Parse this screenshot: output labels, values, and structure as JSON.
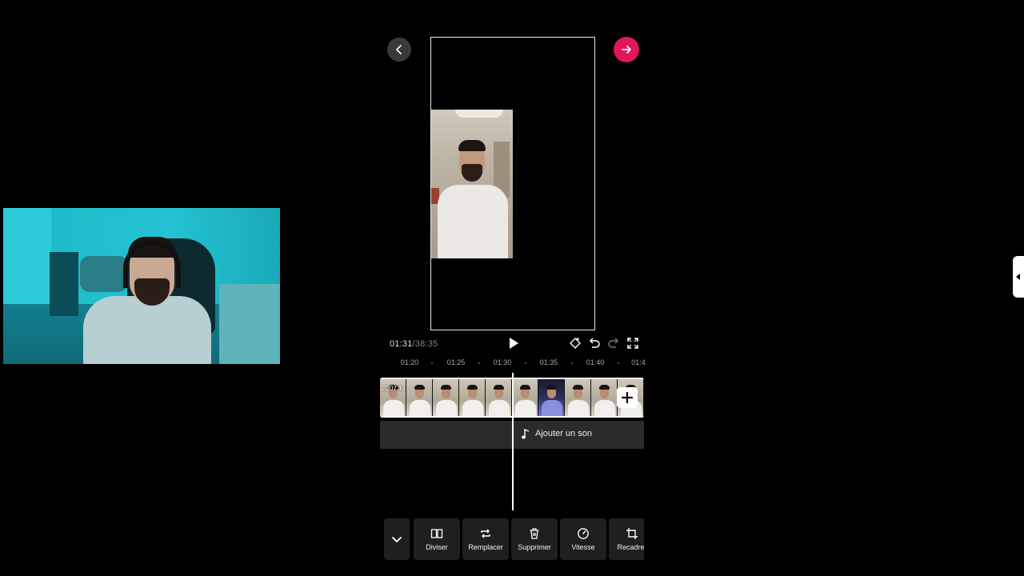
{
  "preview": {
    "current_time": "01:31",
    "separator": "/",
    "total_time": "38:35"
  },
  "ruler": {
    "ticks": [
      "01:20",
      "01:25",
      "01:30",
      "01:35",
      "01:40",
      "01:4"
    ]
  },
  "clip": {
    "duration_label": "2307.1s"
  },
  "audio": {
    "add_sound_label": "Ajouter un son"
  },
  "toolbar": {
    "split_label": "Diviser",
    "replace_label": "Remplacer",
    "delete_label": "Supprimer",
    "speed_label": "Vitesse",
    "crop_label": "Recadrer"
  },
  "colors": {
    "accent": "#e0155c",
    "background": "#000000",
    "tool_bg": "#1f1f1f"
  },
  "icons": [
    "back-icon",
    "next-arrow-icon",
    "play-icon",
    "keyframe-icon",
    "undo-icon",
    "redo-icon",
    "fullscreen-icon",
    "add-clip-icon",
    "music-note-icon",
    "chevron-down-icon",
    "split-icon",
    "replace-icon",
    "trash-icon",
    "speed-icon",
    "crop-icon",
    "side-panel-handle-icon"
  ]
}
